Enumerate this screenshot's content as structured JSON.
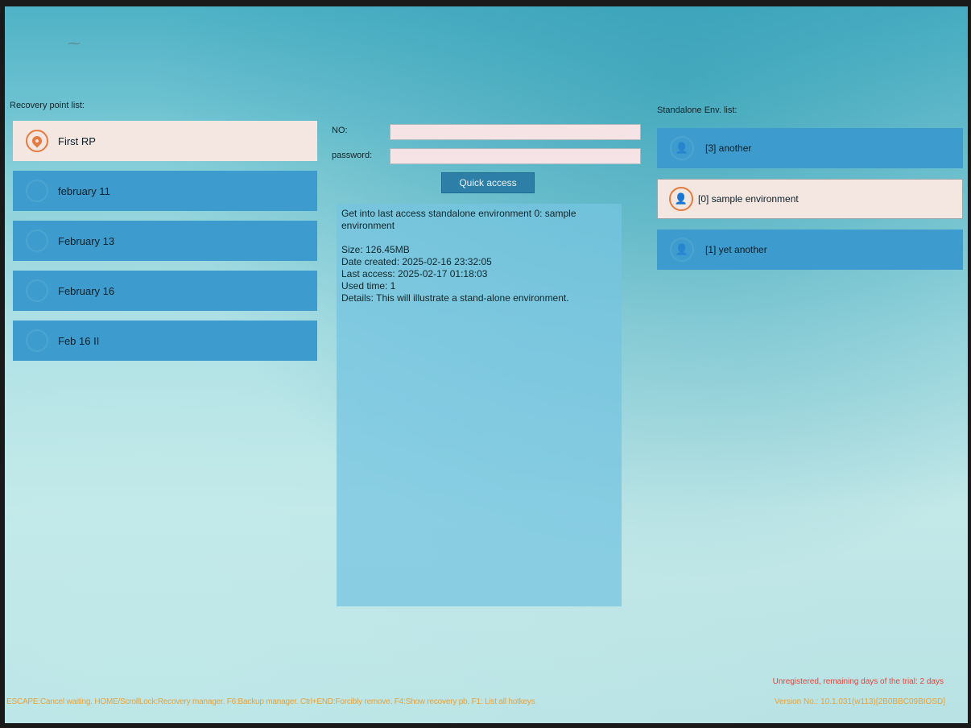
{
  "recovery_points": {
    "label": "Recovery point list:",
    "items": [
      {
        "label": "First RP",
        "selected": true
      },
      {
        "label": "february 11"
      },
      {
        "label": "February 13"
      },
      {
        "label": "February 16"
      },
      {
        "label": "Feb 16 II"
      }
    ]
  },
  "access": {
    "no_label": "NO:",
    "no_value": "",
    "password_label": "password:",
    "password_value": "",
    "quick_access_label": "Quick access"
  },
  "details": {
    "intro": "Get into last access standalone environment 0: sample environment",
    "size": "Size: 126.45MB",
    "date_created": "Date created: 2025-02-16 23:32:05",
    "last_access": "Last access: 2025-02-17 01:18:03",
    "used_time": "Used time: 1",
    "description": "Details: This will illustrate a stand-alone environment."
  },
  "environments": {
    "label": "Standalone Env. list:",
    "items": [
      {
        "label": "[3] another"
      },
      {
        "label": "[0] sample environment",
        "selected": true
      },
      {
        "label": "[1] yet another"
      }
    ]
  },
  "footer": {
    "hotkeys": "ESCAPE:Cancel waiting. HOME/ScrollLock:Recovery manager. F6:Backup manager. Ctrl+END:Forcibly remove. F4:Show recovery pb. F1: List all hotkeys",
    "trial": "Unregistered, remaining days of the trial: 2 days",
    "version": "Version No.: 10.1.031(w113)[2B0BBC09BIOSD]"
  },
  "colors": {
    "list_item": "#3d9ccd",
    "selected_item": "#f4e6e1",
    "accent": "#e47c42",
    "footer_text": "#e7a23a",
    "warning_text": "#e8453a"
  }
}
